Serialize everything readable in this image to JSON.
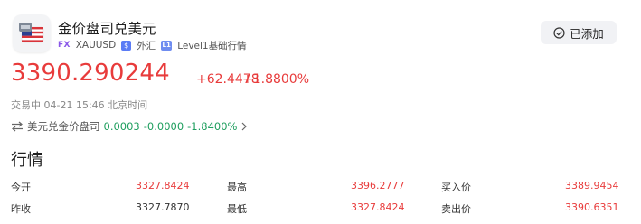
{
  "header": {
    "title": "金价盘司兑美元",
    "tag_fx": "FX",
    "symbol": "XAUUSD",
    "market_icon": "forex-icon",
    "market_label": "外汇",
    "level_icon": "L1",
    "level_label": "Level1基础行情",
    "added_button": "已添加",
    "added_icon": "check-circle-icon"
  },
  "quote": {
    "price": "3390.290244",
    "change": "+62.4478",
    "change_pct": "+1.8800%",
    "status": "交易中 04-21 15:46 北京时间",
    "reverse": {
      "label": "美元兑金价盘司",
      "price": "0.0003",
      "change": "-0.0000",
      "change_pct": "-1.8400%"
    }
  },
  "market": {
    "title": "行情",
    "rows": [
      {
        "l1": "今开",
        "v1": "3327.8424",
        "l2": "最高",
        "v2": "3396.2777",
        "l3": "买入价",
        "v3": "3389.9454"
      },
      {
        "l1": "昨收",
        "v1": "3327.7870",
        "l2": "最低",
        "v2": "3327.8424",
        "l3": "卖出价",
        "v3": "3390.6351"
      }
    ]
  },
  "colors": {
    "up": "#e83b3b",
    "down": "#1e9e5e",
    "fx_tag": "#8a57e8"
  }
}
